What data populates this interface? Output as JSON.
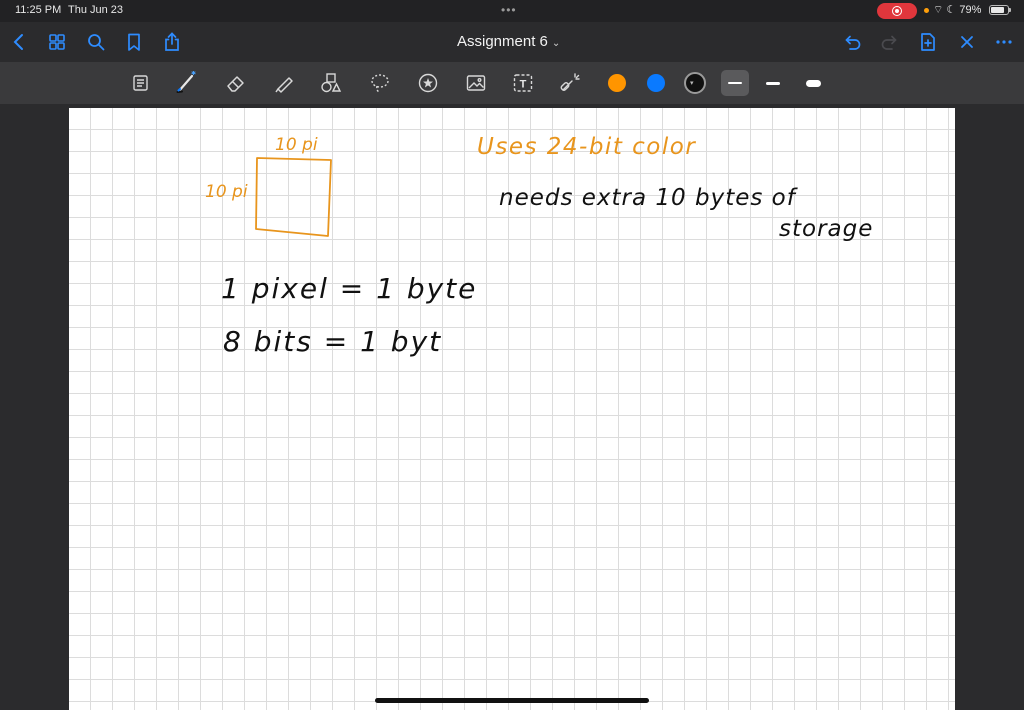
{
  "status_bar": {
    "time": "11:25 PM",
    "date": "Thu Jun 23",
    "multitask_dots": "•••",
    "battery": "79%",
    "battery_level": 0.79
  },
  "nav": {
    "title": "Assignment 6",
    "title_chevron": "⌄"
  },
  "toolbar": {
    "tools": [
      "page-view",
      "pen",
      "eraser",
      "highlighter",
      "shapes",
      "lasso",
      "sticker",
      "image",
      "text",
      "laser-pointer"
    ],
    "colors": {
      "orange": "#ff9500",
      "blue": "#0a7aff",
      "black": "#111111"
    },
    "selected_color": "black",
    "stroke_widths": [
      "thin",
      "medium",
      "thick"
    ],
    "selected_stroke": "thin"
  },
  "canvas": {
    "box_width_label": "10 pi",
    "box_height_label": "10 pi",
    "heading": "Uses 24-bit color",
    "note_line1": "needs extra 10 bytes of",
    "note_line2": "storage",
    "equation1": "1 pixel = 1 byte",
    "equation2": "8 bits = 1 byt"
  }
}
